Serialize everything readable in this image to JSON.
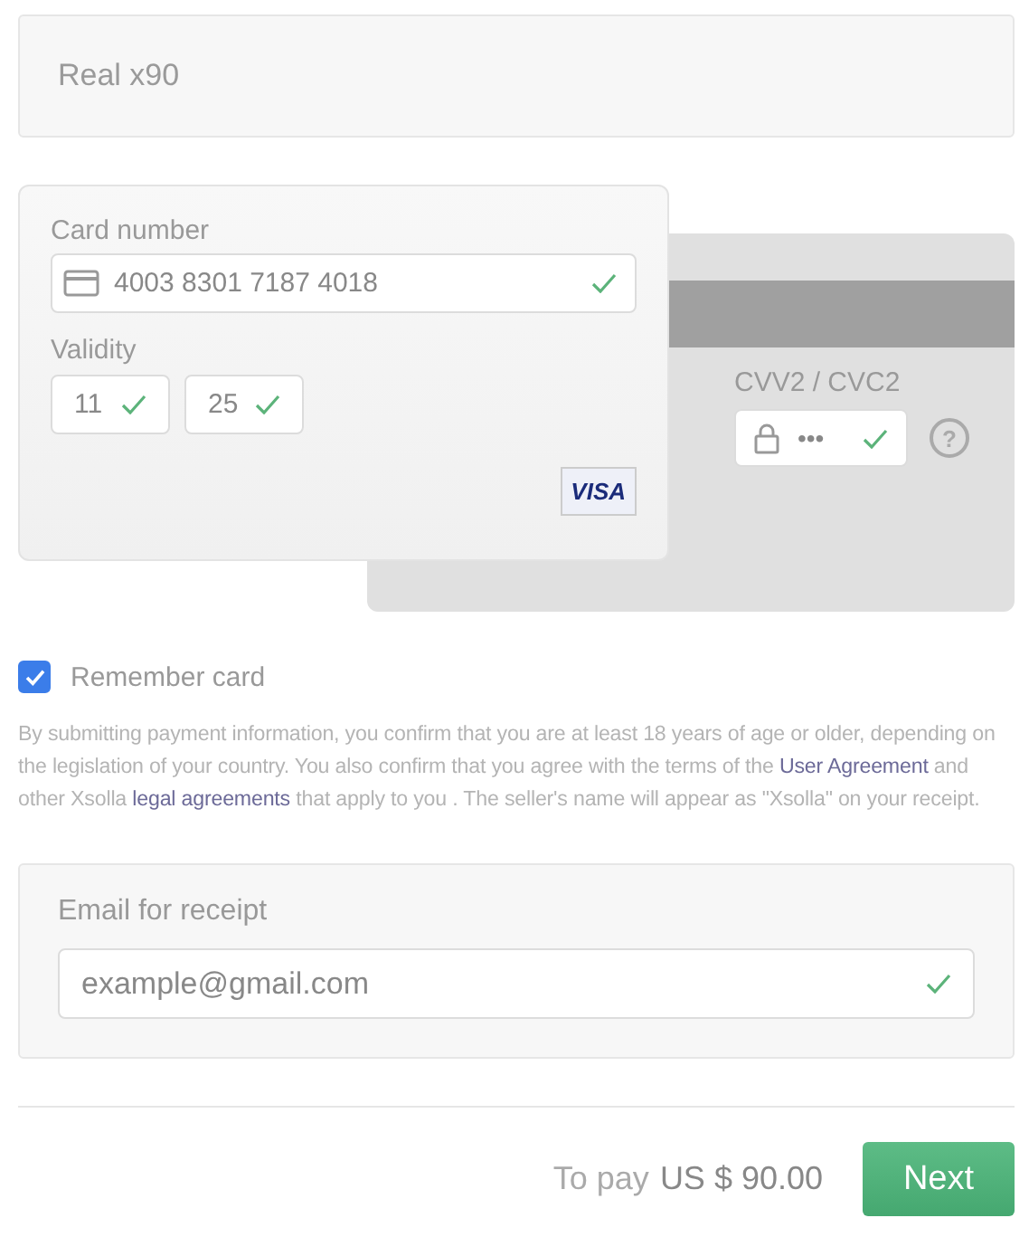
{
  "product": {
    "title": "Real x90"
  },
  "card": {
    "number_label": "Card number",
    "number": "4003 8301 7187 4018",
    "number_valid": true,
    "validity_label": "Validity",
    "validity": [
      {
        "value": "11",
        "valid": true
      },
      {
        "value": "25",
        "valid": true
      }
    ],
    "brand": "VISA",
    "cvv_label": "CVV2 / CVC2",
    "cvv": "•••",
    "cvv_valid": true,
    "help": "?"
  },
  "remember": {
    "label": "Remember card",
    "checked": true
  },
  "consent": [
    {
      "kind": "text",
      "text": "By submitting payment information, you confirm that you are at least 18 years of age or older, depending on the legislation of your country. You also confirm that you agree with the terms of the "
    },
    {
      "kind": "link",
      "text": "User Agreement"
    },
    {
      "kind": "text",
      "text": " and other Xsolla "
    },
    {
      "kind": "link",
      "text": "legal agreements"
    },
    {
      "kind": "text",
      "text": " that apply to you . The seller's name will appear as \"Xsolla\" on your receipt."
    }
  ],
  "email": {
    "label": "Email for receipt",
    "value": "example@gmail.com",
    "valid": true
  },
  "footer": {
    "to_pay_label": "To pay",
    "amount": "US $ 90.00",
    "button": "Next"
  }
}
